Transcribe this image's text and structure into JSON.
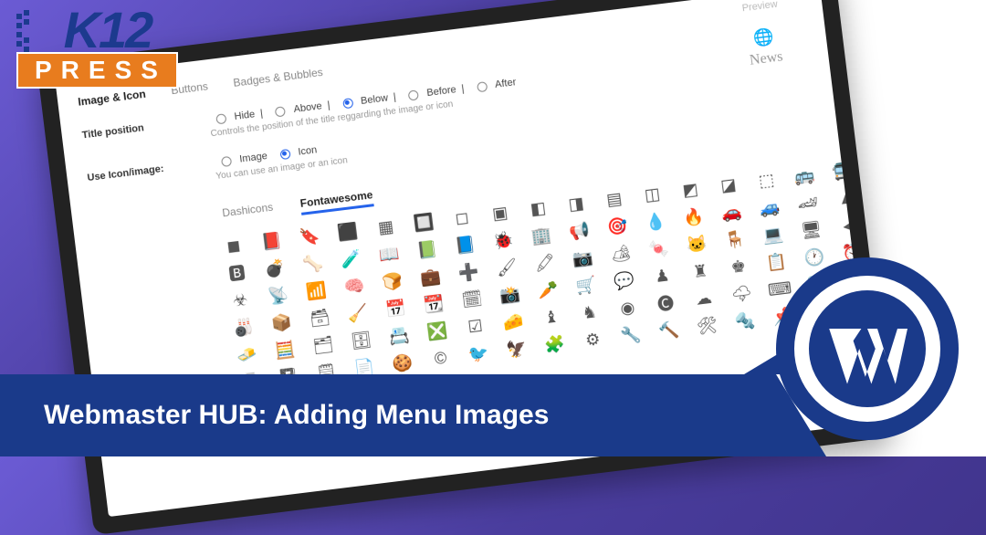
{
  "logo": {
    "top": "K12",
    "bottom": "PRESS"
  },
  "banner": {
    "title": "Webmaster HUB: Adding Menu Images"
  },
  "panel": {
    "tabs": [
      "Image & Icon",
      "Buttons",
      "Badges & Bubbles"
    ],
    "active_tab": "Image & Icon",
    "title_position": {
      "label": "Title position",
      "options": [
        "Hide",
        "Above",
        "Below",
        "Before",
        "After"
      ],
      "selected": "Below",
      "helper": "Controls the position of the title reggarding the image or icon"
    },
    "use_icon": {
      "label": "Use Icon/image:",
      "options": [
        "Image",
        "Icon"
      ],
      "selected": "Icon",
      "helper": "You can use an image or an icon"
    },
    "iconsets": {
      "tabs": [
        "Dashicons",
        "Fontawesome"
      ],
      "active": "Fontawesome"
    },
    "preview": {
      "label": "Preview",
      "item_label": "News"
    }
  }
}
